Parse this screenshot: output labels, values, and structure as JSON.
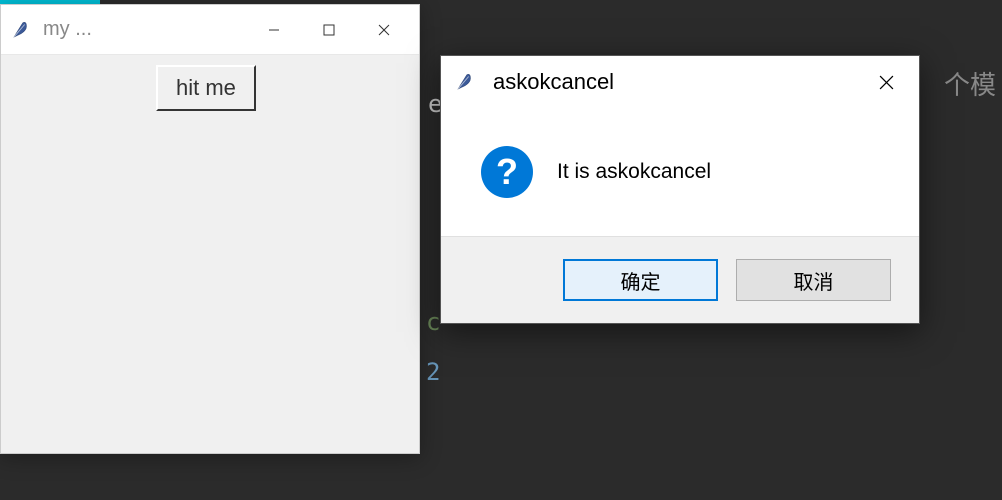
{
  "background": {
    "hints": [
      "e",
      "c",
      "2",
      "个模"
    ]
  },
  "mainWindow": {
    "title": "my ...",
    "button": "hit me"
  },
  "dialog": {
    "title": "askokcancel",
    "message": "It is askokcancel",
    "okLabel": "确定",
    "cancelLabel": "取消",
    "iconGlyph": "?"
  }
}
